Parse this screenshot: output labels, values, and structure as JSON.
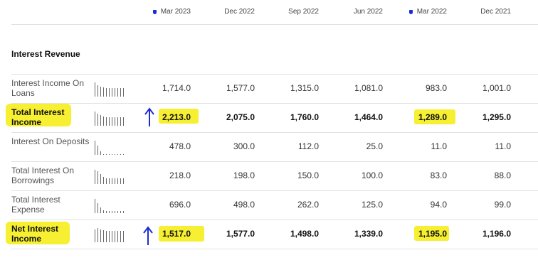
{
  "columns": [
    "Mar 2023",
    "Dec 2022",
    "Sep 2022",
    "Jun 2022",
    "Mar 2022",
    "Dec 2021"
  ],
  "section_title": "Interest Revenue",
  "rows": [
    {
      "label": "Interest Income On Loans",
      "bold": false,
      "values": [
        "1,714.0",
        "1,577.0",
        "1,315.0",
        "1,081.0",
        "983.0",
        "1,001.0"
      ],
      "spark": [
        20,
        16,
        14,
        13,
        12,
        12,
        12,
        12,
        12,
        12,
        12
      ]
    },
    {
      "label": "Total Interest Income",
      "bold": true,
      "values": [
        "2,213.0",
        "2,075.0",
        "1,760.0",
        "1,464.0",
        "1,289.0",
        "1,295.0"
      ],
      "spark": [
        20,
        17,
        15,
        13,
        12,
        12,
        12,
        12,
        12,
        12,
        12
      ]
    },
    {
      "label": "Interest On Deposits",
      "bold": false,
      "values": [
        "478.0",
        "300.0",
        "112.0",
        "25.0",
        "11.0",
        "11.0"
      ],
      "spark": [
        20,
        13,
        5,
        1,
        1,
        1,
        1,
        1,
        1,
        1,
        1
      ]
    },
    {
      "label": "Total Interest On Borrowings",
      "bold": false,
      "values": [
        "218.0",
        "198.0",
        "150.0",
        "100.0",
        "83.0",
        "88.0"
      ],
      "spark": [
        20,
        18,
        14,
        10,
        8,
        8,
        8,
        8,
        8,
        8,
        8
      ]
    },
    {
      "label": "Total Interest Expense",
      "bold": false,
      "values": [
        "696.0",
        "498.0",
        "262.0",
        "125.0",
        "94.0",
        "99.0"
      ],
      "spark": [
        20,
        14,
        8,
        4,
        3,
        3,
        3,
        3,
        3,
        3,
        3
      ]
    },
    {
      "label": "Net Interest Income",
      "bold": true,
      "values": [
        "1,517.0",
        "1,577.0",
        "1,498.0",
        "1,339.0",
        "1,195.0",
        "1,196.0"
      ],
      "spark": [
        18,
        20,
        18,
        17,
        16,
        16,
        16,
        16,
        16,
        16,
        16
      ]
    }
  ],
  "colors": {
    "highlight": "#f6ef32",
    "arrow": "#1d2bd6",
    "marker": "#1d2bd6"
  }
}
